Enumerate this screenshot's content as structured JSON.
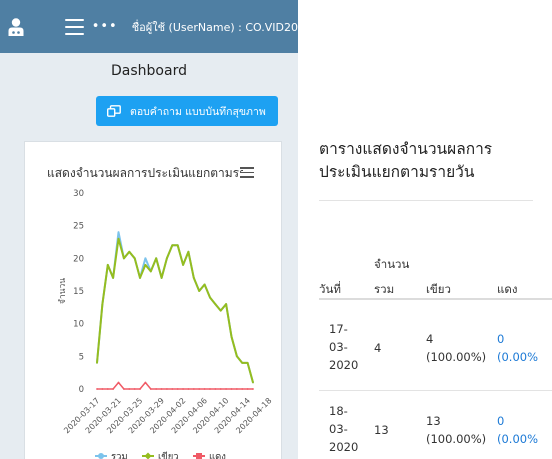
{
  "header": {
    "user_label": "ชื่อผู้ใช้ (UserName) : CO.VID20",
    "dots": "•••"
  },
  "sidebar": {
    "dashboard_title": "Dashboard",
    "assess_button": "ตอบคำถาม แบบบันทึกสุขภาพ"
  },
  "chart_data": {
    "type": "line",
    "title": "แสดงจำนวนผลการประเมินแยกตามรายวัน",
    "ylabel": "จำนวน",
    "xlabel": "",
    "ylim": [
      0,
      30
    ],
    "yticks": [
      "0",
      "5",
      "10",
      "15",
      "20",
      "25",
      "30"
    ],
    "xticks": [
      "2020-03-17",
      "2020-03-21",
      "2020-03-25",
      "2020-03-29",
      "2020-04-02",
      "2020-04-06",
      "2020-04-10",
      "2020-04-14",
      "2020-04-18"
    ],
    "grid": false,
    "legend_position": "bottom",
    "series": [
      {
        "name": "รวม",
        "color": "#7cc3ec",
        "values": [
          4,
          13,
          19,
          17,
          24,
          20,
          21,
          20,
          17,
          20,
          18,
          20,
          17,
          20,
          22,
          22,
          19,
          21,
          17,
          15,
          16,
          14,
          13,
          12,
          13,
          8,
          5,
          4,
          4,
          1
        ]
      },
      {
        "name": "เขียว",
        "color": "#95bd1f",
        "values": [
          4,
          13,
          19,
          17,
          23,
          20,
          21,
          20,
          17,
          19,
          18,
          20,
          17,
          20,
          22,
          22,
          19,
          21,
          17,
          15,
          16,
          14,
          13,
          12,
          13,
          8,
          5,
          4,
          4,
          1
        ]
      },
      {
        "name": "แดง",
        "color": "#f05a66",
        "values": [
          0,
          0,
          0,
          0,
          1,
          0,
          0,
          0,
          0,
          1,
          0,
          0,
          0,
          0,
          0,
          0,
          0,
          0,
          0,
          0,
          0,
          0,
          0,
          0,
          0,
          0,
          0,
          0,
          0,
          0
        ]
      }
    ]
  },
  "table": {
    "title": "ตารางแสดงจำนวนผลการประเมินแยกตามรายวัน",
    "headers": {
      "date": "วันที่",
      "total_line1": "จำนวน",
      "total_line2": "รวม",
      "green": "เขียว",
      "red": "แดง"
    },
    "rows": [
      {
        "date_lines": [
          "17-",
          "03-",
          "2020"
        ],
        "total": "4",
        "green_count": "4",
        "green_pct": "(100.00%)",
        "red_count": "0",
        "red_pct": "(0.00%"
      },
      {
        "date_lines": [
          "18-",
          "03-",
          "2020"
        ],
        "total": "13",
        "green_count": "13",
        "green_pct": "(100.00%)",
        "red_count": "0",
        "red_pct": "(0.00%"
      }
    ]
  }
}
